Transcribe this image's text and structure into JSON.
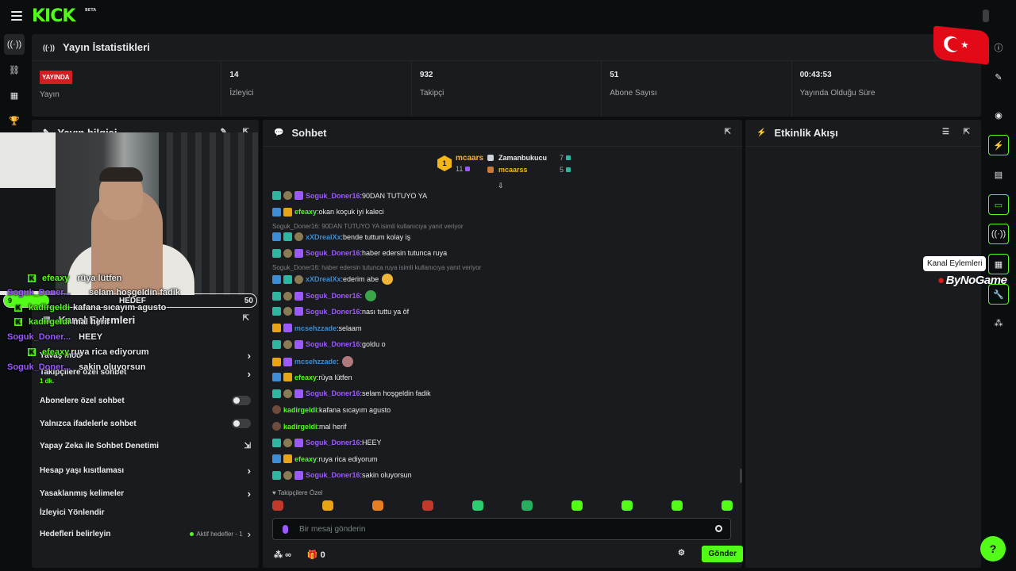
{
  "app": {
    "logo": "KICK",
    "logo_sup": "BETA"
  },
  "stats": {
    "title": "Yayın İstatistikleri",
    "live_badge": "YAYINDA",
    "cells": [
      {
        "value": "",
        "label": "Yayın"
      },
      {
        "value": "14",
        "label": "İzleyici"
      },
      {
        "value": "932",
        "label": "Takipçi"
      },
      {
        "value": "51",
        "label": "Abone Sayısı"
      },
      {
        "value": "00:43:53",
        "label": "Yayında Olduğu Süre"
      }
    ]
  },
  "left_panel": {
    "title": "Yayın bilgisi",
    "actions_title": "Kanal Eylemleri",
    "goal": {
      "start": "9",
      "label": "HEDEF",
      "end": "50",
      "progress": 0.18
    },
    "rows": [
      {
        "label": "Yavaş mod"
      },
      {
        "label": "Takipçilere özel sohbet",
        "sub": "1 dk."
      },
      {
        "label": "Abonelere özel sohbet"
      },
      {
        "label": "Yalnızca ifadelerle sohbet"
      },
      {
        "label": "Yapay Zeka ile Sohbet Denetimi"
      },
      {
        "label": "Hesap yaşı kısıtlaması"
      },
      {
        "label": "Yasaklanmış kelimeler"
      },
      {
        "label": "İzleyici Yönlendir"
      },
      {
        "label": "Hedefleri belirleyin",
        "extra": "Aktif hedefler - 1"
      }
    ],
    "overlay_chat": [
      {
        "name": "efeaxy",
        "text": "rüya lütfen",
        "color": "#53fc18"
      },
      {
        "name": "Soguk_Doner...",
        "text": "selam hoşgeldin fadik",
        "color": "#9b59ff"
      },
      {
        "name": "kadirgeldi",
        "text": "kafana sıcayım agusto",
        "color": "#53fc18"
      },
      {
        "name": "kadirgeldi",
        "text": "mal herif",
        "color": "#53fc18"
      },
      {
        "name": "Soguk_Doner...",
        "text": "HEEY",
        "color": "#9b59ff"
      },
      {
        "name": "efeaxy",
        "text": "ruya rica ediyorum",
        "color": "#53fc18"
      },
      {
        "name": "Soguk_Doner...",
        "text": "sakin oluyorsun",
        "color": "#9b59ff"
      }
    ]
  },
  "chat": {
    "title": "Sohbet",
    "top_gifters": {
      "first": {
        "rank": "1",
        "name": "mcaars",
        "count": "11"
      },
      "second": {
        "name": "Zamanbukucu",
        "count": "7"
      },
      "third": {
        "name": "mcaarss",
        "count": "5"
      }
    },
    "messages": [
      {
        "badges": [
          "og",
          "gift",
          "sub"
        ],
        "user": "Soguk_Doner16",
        "color": "#9b59ff",
        "text": "90DAN TUTUYO YA"
      },
      {
        "badges": [
          "vip",
          "crown"
        ],
        "user": "efeaxy",
        "color": "#53fc18",
        "text": "okan koçuk iyi kaleci"
      },
      {
        "reply": "Soguk_Doner16: 90DAN TUTUYO YA isimli kullanıcıya yanıt veriyor"
      },
      {
        "badges": [
          "vip",
          "og",
          "gift"
        ],
        "user": "xXDrealXx",
        "color": "#3b8ed6",
        "text": "bende tuttum kolay iş"
      },
      {
        "badges": [
          "og",
          "gift",
          "sub"
        ],
        "user": "Soguk_Doner16",
        "color": "#9b59ff",
        "text": "haber edersin tutunca ruya"
      },
      {
        "reply": "Soguk_Doner16: haber edersin tutunca ruya isimli kullanıcıya yanıt veriyor"
      },
      {
        "badges": [
          "vip",
          "og",
          "gift"
        ],
        "user": "xXDrealXx",
        "color": "#3b8ed6",
        "text": "ederim abe",
        "emote": "#f0b63a"
      },
      {
        "badges": [
          "og",
          "gift",
          "sub"
        ],
        "user": "Soguk_Doner16",
        "color": "#9b59ff",
        "text": "",
        "emote": "#3aa648"
      },
      {
        "badges": [
          "og",
          "gift",
          "sub"
        ],
        "user": "Soguk_Doner16",
        "color": "#9b59ff",
        "text": "nası tuttu ya öf"
      },
      {
        "badges": [
          "crown",
          "sub"
        ],
        "user": "mcsehzzade",
        "color": "#3b8ed6",
        "text": "selaam"
      },
      {
        "badges": [
          "og",
          "gift",
          "sub"
        ],
        "user": "Soguk_Doner16",
        "color": "#9b59ff",
        "text": "goldu o"
      },
      {
        "badges": [
          "crown",
          "sub"
        ],
        "user": "mcsehzzade",
        "color": "#3b8ed6",
        "text": "",
        "emote": "#b07a7a"
      },
      {
        "badges": [
          "vip",
          "crown"
        ],
        "user": "efeaxy",
        "color": "#53fc18",
        "text": "rüya lütfen"
      },
      {
        "badges": [
          "og",
          "gift",
          "sub"
        ],
        "user": "Soguk_Doner16",
        "color": "#9b59ff",
        "text": "selam hoşgeldin fadik"
      },
      {
        "badges": [
          "mod"
        ],
        "user": "kadirgeldi",
        "color": "#53fc18",
        "text": "kafana sıcayım agusto"
      },
      {
        "badges": [
          "mod"
        ],
        "user": "kadirgeldi",
        "color": "#53fc18",
        "text": "mal herif"
      },
      {
        "badges": [
          "og",
          "gift",
          "sub"
        ],
        "user": "Soguk_Doner16",
        "color": "#9b59ff",
        "text": "HEEY"
      },
      {
        "badges": [
          "vip",
          "crown"
        ],
        "user": "efeaxy",
        "color": "#53fc18",
        "text": "ruya rica ediyorum"
      },
      {
        "badges": [
          "og",
          "gift",
          "sub"
        ],
        "user": "Soguk_Doner16",
        "color": "#9b59ff",
        "text": "sakin oluyorsun"
      }
    ],
    "followers_only": "Takipçilere Özel",
    "emotes": [
      "#c0392b",
      "#e9a317",
      "#e67e22",
      "#c0392b",
      "#2ecc71",
      "#27ae60",
      "#53fc18",
      "#53fc18",
      "#53fc18",
      "#53fc18"
    ],
    "input_placeholder": "Bir mesaj gönderin",
    "footer": {
      "infinity": "∞",
      "gift_count": "0",
      "send": "Gönder"
    }
  },
  "activity": {
    "title": "Etkinlik Akışı"
  },
  "tooltip": "Kanal Eylemleri",
  "watermark": "ByNoGame"
}
